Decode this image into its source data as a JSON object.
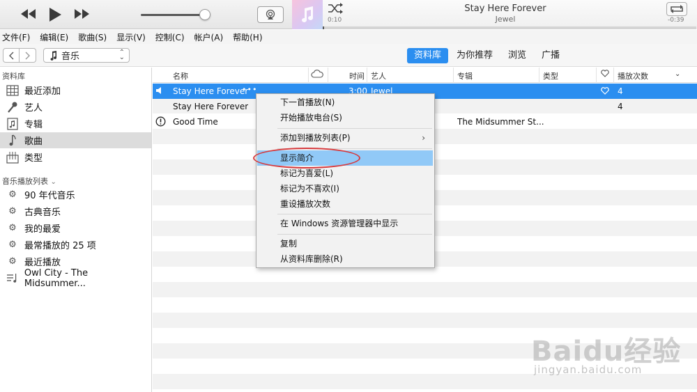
{
  "player": {
    "now_playing_title": "Stay Here Forever",
    "now_playing_artist": "Jewel",
    "elapsed": "0:10",
    "remaining": "-0:39",
    "progress_fraction": 0.0,
    "volume_fraction": 0.92
  },
  "menubar": {
    "items": [
      "文件(F)",
      "编辑(E)",
      "歌曲(S)",
      "显示(V)",
      "控制(C)",
      "帐户(A)",
      "帮助(H)"
    ]
  },
  "toolbar": {
    "media_label": "音乐",
    "tabs": [
      "资料库",
      "为你推荐",
      "浏览",
      "广播"
    ],
    "active_tab": "资料库"
  },
  "sidebar": {
    "library_heading": "资料库",
    "library_items": [
      "最近添加",
      "艺人",
      "专辑",
      "歌曲",
      "类型"
    ],
    "selected_item": "歌曲",
    "playlists_heading": "音乐播放列表",
    "playlists_chevron": "⌄",
    "playlists": [
      "90 年代音乐",
      "古典音乐",
      "我的最爱",
      "最常播放的 25 项",
      "最近播放",
      "Owl City - The Midsummer..."
    ]
  },
  "table": {
    "headers": {
      "name": "名称",
      "time": "时间",
      "artist": "艺人",
      "album": "专辑",
      "genre": "类型",
      "plays": "播放次数"
    },
    "rows": [
      {
        "name": "Stay Here Forever",
        "more": "•••",
        "time": "3:00",
        "artist": "Jewel",
        "album": "",
        "loved": true,
        "plays": "4",
        "selected": true,
        "playing": true
      },
      {
        "name": "Stay Here Forever",
        "more": "",
        "time": "",
        "artist": "",
        "album": "",
        "loved": false,
        "plays": "4",
        "selected": false,
        "playing": false
      },
      {
        "name": "Good Time",
        "more": "",
        "time": "",
        "artist": "",
        "album": "The Midsummer St...",
        "loved": false,
        "plays": "",
        "selected": false,
        "playing": false,
        "warning": true
      }
    ]
  },
  "context_menu": {
    "items": [
      {
        "label": "下一首播放(N)"
      },
      {
        "label": "开始播放电台(S)"
      },
      {
        "label": "添加到播放列表(P)",
        "submenu": "›"
      },
      {
        "label": "显示简介",
        "highlighted": true
      },
      {
        "label": "标记为喜爱(L)"
      },
      {
        "label": "标记为不喜欢(I)"
      },
      {
        "label": "重设播放次数"
      },
      {
        "label": "在 Windows 资源管理器中显示"
      },
      {
        "label": "复制"
      },
      {
        "label": "从资料库删除(R)"
      }
    ]
  },
  "watermark": {
    "logo": "Baidu经验",
    "url": "jingyan.baidu.com"
  },
  "colors": {
    "accent": "#2b8ef0",
    "menu_highlight": "#91c9f7",
    "annotation": "#d7393c"
  }
}
